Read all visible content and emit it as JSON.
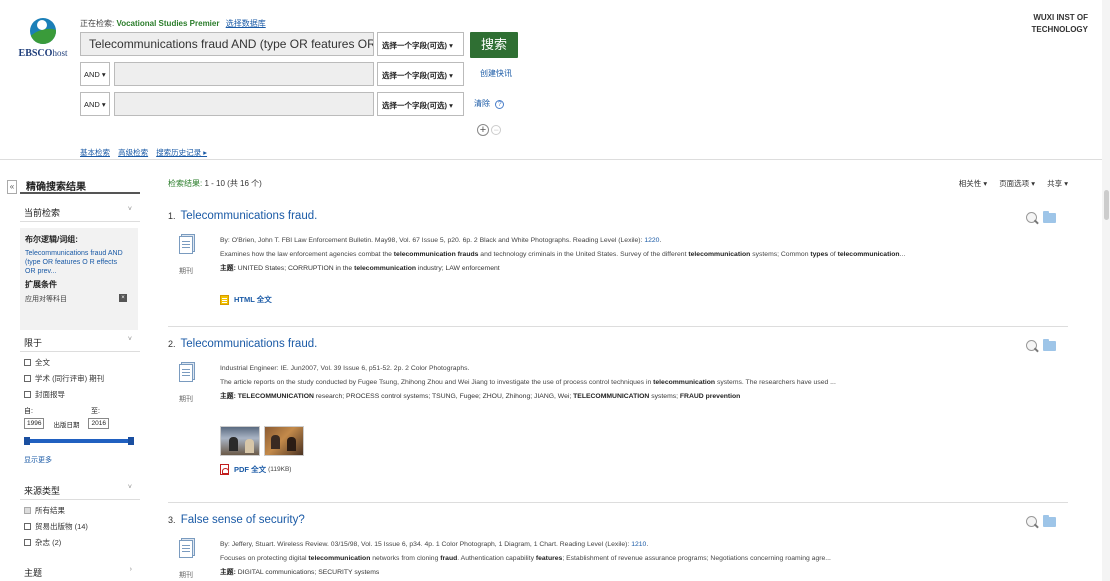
{
  "logo": {
    "brand": "EBSCO",
    "suffix": "host"
  },
  "header": {
    "searching_label": "正在检索:",
    "database": "Vocational Studies Premier",
    "choose_db": "选择数据库",
    "institution_line1": "WUXI INST OF",
    "institution_line2": "TECHNOLOGY"
  },
  "search": {
    "main_query": "Telecommunications fraud AND (type OR features OR effe",
    "field_select": "选择一个字段(可选) ▾",
    "bool_op": "AND ▾",
    "button": "搜索",
    "create_alert": "创建快讯",
    "clear": "清除",
    "help": "?",
    "plus": "+",
    "minus": "−",
    "links": [
      "基本检索",
      "高级检索",
      "搜索历史记录 ▸"
    ]
  },
  "sidebar": {
    "collapse": "«",
    "title": "精确搜索结果",
    "current": {
      "head": "当前检索",
      "chevron": "˅",
      "bool_label": "布尔逻辑/词组:",
      "query_link": "Telecommunications fraud AND (type OR features O R effects OR prev...",
      "expand_label": "扩展条件",
      "expand_item": "应用对等科目",
      "remove": "×"
    },
    "limit": {
      "head": "限于",
      "chevron": "˅",
      "options": [
        "全文",
        "学术 (同行评审) 期刊",
        "封面报导"
      ],
      "from_label": "自:",
      "to_label": "至:",
      "from_year": "1996",
      "pub_date": "出版日期",
      "to_year": "2016",
      "show_more": "显示更多"
    },
    "source": {
      "head": "来源类型",
      "chevron": "˅",
      "options": [
        "所有结果",
        "贸易出版物 (14)",
        "杂志 (2)"
      ]
    },
    "subject": {
      "head": "主题",
      "chevron": "›"
    }
  },
  "results": {
    "count_label": "检索结果:",
    "count_value": "1 - 10 (共 16 个)",
    "tools": [
      "相关性 ▾",
      "页面选项 ▾",
      "共享 ▾"
    ],
    "records": [
      {
        "num": "1.",
        "title": "Telecommunications fraud.",
        "type": "期刊",
        "citation": "By: O'Brien, John T. FBI Law Enforcement Bulletin. May98, Vol. 67 Issue 5, p20. 6p. 2 Black and White Photographs. Reading Level (Lexile):",
        "lexile": "1220",
        "abstract_a": "Examines how the law enforcement agencies combat the ",
        "abstract_b": "telecommunication frauds",
        "abstract_c": " and technology criminals in the United States. Survey of the different ",
        "abstract_d": "telecommunication",
        "abstract_e": " systems; Common ",
        "abstract_f": "types",
        "abstract_g": " of ",
        "abstract_h": "telecommunication",
        "abstract_i": "...",
        "subject_label": "主题:",
        "subject_a": " UNITED States; CORRUPTION in the ",
        "subject_b": "telecommunication",
        "subject_c": " industry; LAW enforcement",
        "fulltext": "HTML 全文"
      },
      {
        "num": "2.",
        "title": "Telecommunications fraud.",
        "type": "期刊",
        "citation": "Industrial Engineer: IE. Jun2007, Vol. 39 Issue 6, p51-52. 2p. 2 Color Photographs.",
        "abstract_a": "The article reports on the study conducted by Fugee Tsung, Zhihong Zhou and Wei Jiang to investigate the use of process control techniques in ",
        "abstract_b": "telecommunication",
        "abstract_c": " systems. The researchers have used ...",
        "subject_label": "主题:",
        "subject_a": "TELECOMMUNICATION",
        "subject_b": " research; PROCESS control systems; TSUNG, Fugee; ZHOU, Zhihong; JIANG, Wei; ",
        "subject_c": "TELECOMMUNICATION",
        "subject_d": " systems; ",
        "subject_e": "FRAUD prevention",
        "fulltext": "PDF 全文",
        "filesize": "(119KB)"
      },
      {
        "num": "3.",
        "title": "False sense of security?",
        "type": "期刊",
        "citation": "By: Jeffery, Stuart. Wireless Review. 03/15/98, Vol. 15 Issue 6, p34. 4p. 1 Color Photograph, 1 Diagram, 1 Chart. Reading Level (Lexile):",
        "lexile": "1210",
        "abstract_a": "Focuses on protecting digital ",
        "abstract_b": "telecommunication",
        "abstract_c": " networks from cloning ",
        "abstract_d": "fraud",
        "abstract_e": ". Authentication capability ",
        "abstract_f": "features",
        "abstract_g": "; Establishment of revenue assurance programs; Negotiations concerning roaming agre...",
        "subject_label": "主题:",
        "subject_a": " DIGITAL communications; SECURITY systems"
      }
    ]
  }
}
